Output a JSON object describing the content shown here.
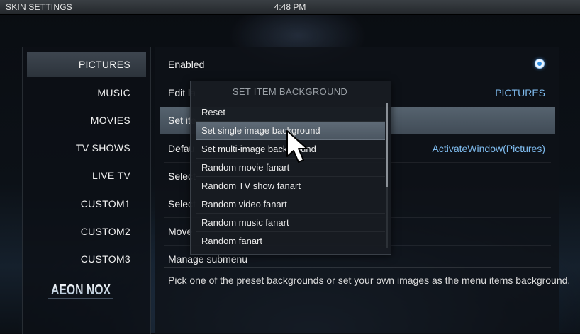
{
  "header": {
    "title": "SKIN SETTINGS",
    "clock": "4:48 PM"
  },
  "sidebar": {
    "items": [
      {
        "label": "PICTURES",
        "active": true
      },
      {
        "label": "MUSIC"
      },
      {
        "label": "MOVIES"
      },
      {
        "label": "TV SHOWS"
      },
      {
        "label": "LIVE TV"
      },
      {
        "label": "CUSTOM1"
      },
      {
        "label": "CUSTOM2"
      },
      {
        "label": "CUSTOM3"
      }
    ],
    "brand": "AEON NOX"
  },
  "settings": {
    "rows": [
      {
        "label": "Enabled",
        "value": ""
      },
      {
        "label": "Edit la",
        "value": "PICTURES"
      },
      {
        "label": "Set ite",
        "value": ""
      },
      {
        "label": "Defau",
        "value": "ActivateWindow(Pictures)"
      },
      {
        "label": "Select",
        "value": ""
      },
      {
        "label": "Select",
        "value": ""
      },
      {
        "label": "Move",
        "value": ""
      },
      {
        "label": "Manage submenu",
        "value": ""
      }
    ],
    "description": "Pick one of the preset backgrounds or set your own images as the menu items background."
  },
  "dialog": {
    "title": "SET ITEM BACKGROUND",
    "items": [
      "Reset",
      "Set single image background",
      "Set multi-image background",
      "Random movie fanart",
      "Random TV show fanart",
      "Random video fanart",
      "Random music fanart",
      "Random fanart"
    ],
    "selected_index": 1
  },
  "colors": {
    "accent_value": "#7fbcef",
    "toggle_on": "#2e8fe6"
  }
}
